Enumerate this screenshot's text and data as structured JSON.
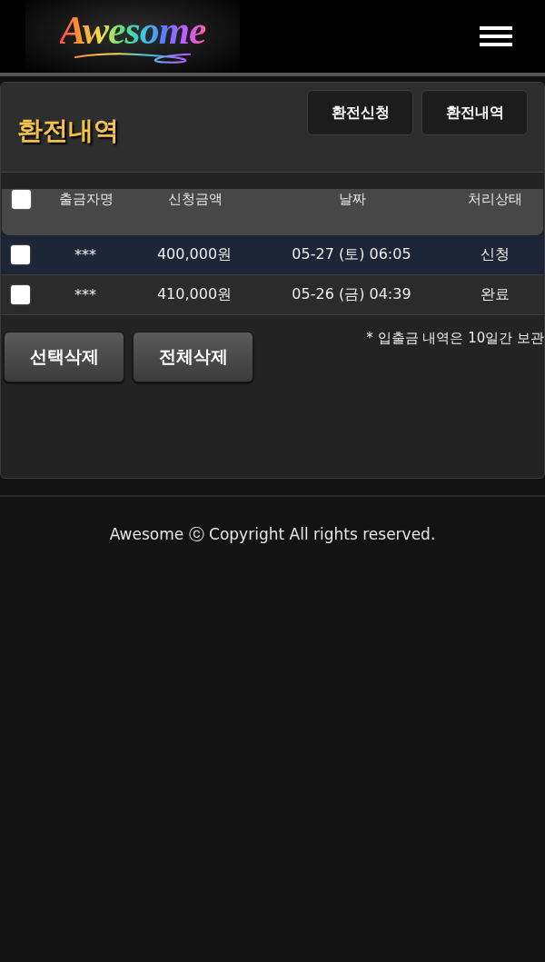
{
  "header": {
    "logo": "Awesome"
  },
  "panel": {
    "title": "환전내역",
    "actions": [
      {
        "label": "환전신청"
      },
      {
        "label": "환전내역"
      }
    ]
  },
  "table": {
    "select_all": {
      "checked": false
    },
    "columns": [
      "출금자명",
      "신청금액",
      "날짜",
      "처리상태"
    ],
    "rows": [
      {
        "checked": false,
        "highlighted": true,
        "cells": [
          "***",
          "400,000원",
          "05-27 (토) 06:05",
          "신청"
        ]
      },
      {
        "checked": false,
        "highlighted": false,
        "cells": [
          "***",
          "410,000원",
          "05-26 (금) 04:39",
          "완료"
        ]
      }
    ]
  },
  "buttons": [
    {
      "label": "선택삭제"
    },
    {
      "label": "전체삭제"
    }
  ],
  "note": "* 입출금 내역은 10일간 보관",
  "footer": "Awesome ⓒ Copyright All rights reserved."
}
